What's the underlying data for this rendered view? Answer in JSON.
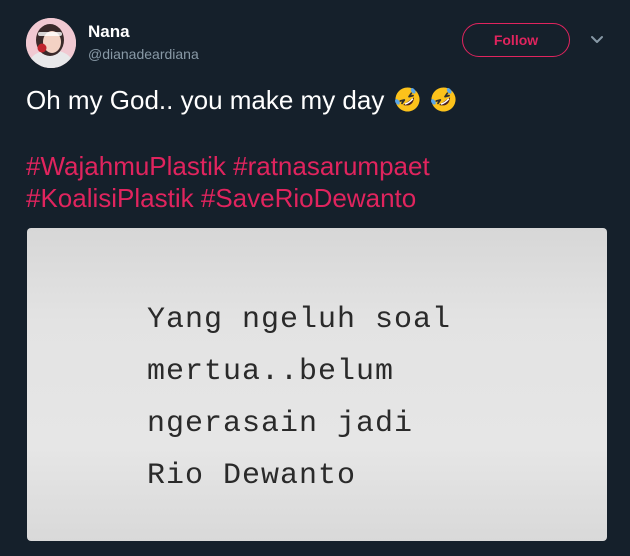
{
  "user": {
    "name": "Nana",
    "handle": "@dianadeardiana",
    "avatar_icon": "profile-photo"
  },
  "header": {
    "follow_label": "Follow",
    "menu_icon": "chevron-down-icon"
  },
  "tweet": {
    "text": "Oh my God.. you make my day",
    "emoji": [
      "rolling-on-floor-laughing",
      "rolling-on-floor-laughing"
    ],
    "hashtags": [
      "#WajahmuPlastik",
      "#ratnasarumpaet",
      "#KoalisiPlastik",
      "#SaveRioDewanto"
    ]
  },
  "media": {
    "lines": [
      "Yang ngeluh soal",
      "mertua..belum",
      "ngerasain jadi",
      "Rio Dewanto"
    ]
  },
  "colors": {
    "background": "#15202b",
    "accent": "#e0245e",
    "secondary_text": "#8899a6"
  }
}
